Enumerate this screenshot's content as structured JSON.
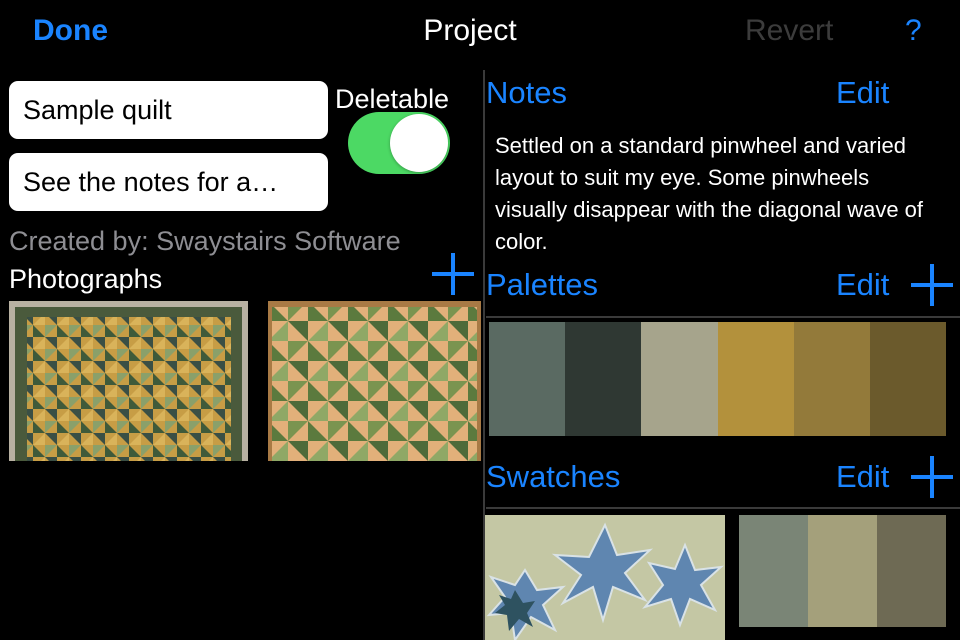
{
  "nav": {
    "done_label": "Done",
    "title": "Project",
    "revert_label": "Revert",
    "help_label": "?"
  },
  "project": {
    "name_value": "Sample quilt",
    "notes_value": "See the notes for a…",
    "deletable_label": "Deletable",
    "deletable_on": true,
    "created_by": "Created by: Swaystairs Software",
    "photographs_label": "Photographs"
  },
  "notes": {
    "title": "Notes",
    "edit_label": "Edit",
    "text": "Settled on a standard pinwheel and varied layout to suit my eye. Some pinwheels visually disappear with the diagonal wave of color."
  },
  "palettes": {
    "title": "Palettes",
    "edit_label": "Edit",
    "colors": [
      "#5a6a62",
      "#2f3833",
      "#a6a48c",
      "#b3913c",
      "#937a3a",
      "#6b5a2c"
    ]
  },
  "swatches": {
    "title": "Swatches",
    "edit_label": "Edit",
    "colors": [
      "#7a8576",
      "#a4a07b",
      "#6e6a54"
    ]
  },
  "colors": {
    "accent": "#1a84ff",
    "toggle_on": "#4cd964",
    "disabled": "#3c3c3c",
    "secondary_text": "#8e8e93"
  }
}
